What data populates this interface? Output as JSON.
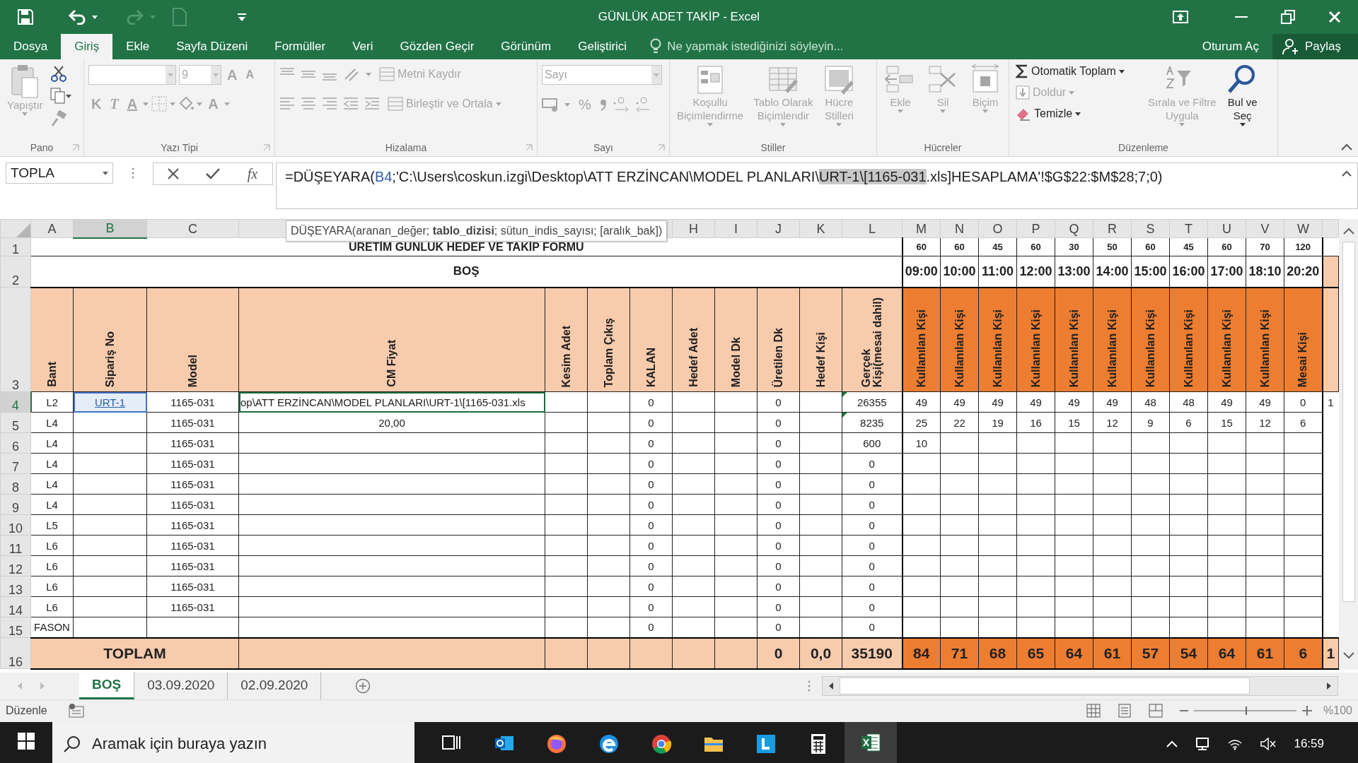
{
  "window": {
    "title": "GÜNLÜK ADET TAKİP - Excel"
  },
  "menu": {
    "tabs": [
      {
        "label": "Dosya",
        "selected": false
      },
      {
        "label": "Giriş",
        "selected": true
      },
      {
        "label": "Ekle",
        "selected": false
      },
      {
        "label": "Sayfa Düzeni",
        "selected": false
      },
      {
        "label": "Formüller",
        "selected": false
      },
      {
        "label": "Veri",
        "selected": false
      },
      {
        "label": "Gözden Geçir",
        "selected": false
      },
      {
        "label": "Görünüm",
        "selected": false
      },
      {
        "label": "Geliştirici",
        "selected": false
      }
    ],
    "tell_me": "Ne yapmak istediğinizi söyleyin...",
    "sign_in": "Oturum Aç",
    "share": "Paylaş"
  },
  "ribbon": {
    "groups": [
      {
        "kind": "clipboard",
        "label": "Pano",
        "paste": {
          "label": "Yapıştır",
          "disabled": true
        }
      },
      {
        "kind": "font",
        "label": "Yazı Tipi",
        "font_size": "9",
        "glyphs": [
          {
            "kind": "grow",
            "text": "A"
          },
          {
            "kind": "shrink",
            "text": "A"
          },
          {
            "kind": "bold",
            "text": "K"
          },
          {
            "kind": "italic",
            "text": "T"
          },
          {
            "kind": "underline",
            "text": "A"
          },
          {
            "kind": "color",
            "text": "A"
          }
        ]
      },
      {
        "kind": "alignment",
        "label": "Hizalama",
        "buttons": [
          {
            "label": "Metni Kaydır",
            "disabled": true
          },
          {
            "label": "Birleştir ve Ortala",
            "disabled": true
          }
        ]
      },
      {
        "kind": "number",
        "label": "Sayı",
        "format": "Sayı",
        "percent": "%"
      },
      {
        "kind": "styles",
        "label": "Stiller",
        "buttons": [
          {
            "lines": [
              "Koşullu",
              "Biçimlendirme"
            ],
            "disabled": true
          },
          {
            "lines": [
              "Tablo Olarak",
              "Biçimlendir"
            ],
            "disabled": true
          },
          {
            "lines": [
              "Hücre",
              "Stilleri"
            ],
            "disabled": true
          }
        ]
      },
      {
        "kind": "cells",
        "label": "Hücreler",
        "buttons": [
          {
            "lines": [
              "Ekle"
            ],
            "disabled": true
          },
          {
            "lines": [
              "Sil"
            ],
            "disabled": true
          },
          {
            "lines": [
              "Biçim"
            ],
            "disabled": true
          }
        ]
      },
      {
        "kind": "editing",
        "label": "Düzenleme",
        "small": [
          {
            "kind": "autosum",
            "label": "Otomatik Toplam",
            "disabled": false
          },
          {
            "kind": "fill",
            "label": "Doldur",
            "disabled": true
          },
          {
            "kind": "clear",
            "label": "Temizle",
            "disabled": false
          }
        ],
        "large": [
          {
            "kind": "sort",
            "lines": [
              "Sırala ve Filtre",
              "Uygula"
            ],
            "disabled": true
          },
          {
            "kind": "find",
            "lines": [
              "Bul ve",
              "Seç"
            ],
            "disabled": false
          }
        ]
      }
    ]
  },
  "formula_bar": {
    "name_box": "TOPLA",
    "fx": "fx",
    "formula": [
      {
        "kind": "plain",
        "text": "=DÜŞEYARA("
      },
      {
        "kind": "reference",
        "text": "B4"
      },
      {
        "kind": "plain",
        "text": ";'C:\\Users\\coskun.izgi\\Desktop\\ATT ERZİNCAN\\MODEL PLANLARI\\"
      },
      {
        "kind": "highlighted",
        "text": "URT-1\\[1165-031"
      },
      {
        "kind": "plain",
        "text": ".xls]HESAPLAMA'!$G$22:$M$28;7;0)"
      }
    ]
  },
  "sheet": {
    "column_headers": [
      "A",
      "B",
      "C",
      "H",
      "I",
      "J",
      "K",
      "L",
      "M",
      "N",
      "O",
      "P",
      "Q",
      "R",
      "S",
      "T",
      "U",
      "V",
      "W"
    ],
    "tooltip": "DÜŞEYARA(aranan_değer; **tablo_dizisi**; sütun_indis_sayısı; [aralık_bak])",
    "rows": [
      {
        "number": "1",
        "kind": "targets",
        "title": "ÜRETİM GÜNLÜK HEDEF VE TAKİP FORMU",
        "cells": {
          "col_13": "60",
          "col_14": "60",
          "col_15": "45",
          "col_16": "60",
          "col_17": "30",
          "col_18": "50",
          "col_19": "60",
          "col_20": "45",
          "col_21": "60",
          "col_22": "70",
          "col_23": "120"
        }
      },
      {
        "number": "2",
        "kind": "times",
        "title": "BOŞ",
        "cells": {
          "col_13": "09:00",
          "col_14": "10:00",
          "col_15": "11:00",
          "col_16": "12:00",
          "col_17": "13:00",
          "col_18": "14:00",
          "col_19": "15:00",
          "col_20": "16:00",
          "col_21": "17:00",
          "col_22": "18:10",
          "col_23": "20:20"
        }
      },
      {
        "number": "3",
        "kind": "header",
        "cells": {
          "col_1": "Bant",
          "col_2": "Sipariş No",
          "col_3": "Model",
          "col_4": "CM Fiyat",
          "col_5": "Kesim Adet",
          "col_6": "Toplam Çıkış",
          "col_7": "KALAN",
          "col_8": "Hedef Adet",
          "col_9": "Model Dk",
          "col_10": "Üretilen Dk",
          "col_11": "Hedef Kişi",
          "col_12": {
            "lines": [
              "Gerçek",
              "Kişi(mesai dahil)"
            ]
          },
          "col_13": "Kullanılan Kişi",
          "col_14": "Kullanılan Kişi",
          "col_15": "Kullanılan Kişi",
          "col_16": "Kullanılan Kişi",
          "col_17": "Kullanılan Kişi",
          "col_18": "Kullanılan Kişi",
          "col_19": "Kullanılan Kişi",
          "col_20": "Kullanılan Kişi",
          "col_21": "Kullanılan Kişi",
          "col_22": "Kullanılan Kişi",
          "col_23": "Mesai Kişi"
        }
      },
      {
        "number": "4",
        "kind": "data",
        "cells": {
          "col_1": "L2",
          "col_2": {
            "text": "URT-1",
            "selected": true,
            "link": true
          },
          "col_3": "1165-031",
          "col_4": {
            "text": "op\\ATT ERZİNCAN\\MODEL PLANLARI\\URT-1\\[1165-031.xls",
            "editing": true
          },
          "col_7": "0",
          "col_10": "0",
          "col_12": {
            "text": "26355",
            "flagged": true
          },
          "col_13": "49",
          "col_14": "49",
          "col_15": "49",
          "col_16": "49",
          "col_17": "49",
          "col_18": "49",
          "col_19": "48",
          "col_20": "48",
          "col_21": "49",
          "col_22": "49",
          "col_23": "0",
          "col_24": "1"
        }
      },
      {
        "number": "5",
        "kind": "data",
        "cells": {
          "col_1": "L4",
          "col_3": "1165-031",
          "col_4": "20,00",
          "col_7": "0",
          "col_10": "0",
          "col_12": {
            "text": "8235",
            "flagged": true
          },
          "col_13": "25",
          "col_14": "22",
          "col_15": "19",
          "col_16": "16",
          "col_17": "15",
          "col_18": "12",
          "col_19": "9",
          "col_20": "6",
          "col_21": "15",
          "col_22": "12",
          "col_23": "6"
        }
      },
      {
        "number": "6",
        "kind": "data",
        "cells": {
          "col_1": "L4",
          "col_3": "1165-031",
          "col_7": "0",
          "col_10": "0",
          "col_12": "600",
          "col_13": "10"
        }
      },
      {
        "number": "7",
        "kind": "data",
        "cells": {
          "col_1": "L4",
          "col_3": "1165-031",
          "col_7": "0",
          "col_10": "0",
          "col_12": "0"
        }
      },
      {
        "number": "8",
        "kind": "data",
        "cells": {
          "col_1": "L4",
          "col_3": "1165-031",
          "col_7": "0",
          "col_10": "0",
          "col_12": "0"
        }
      },
      {
        "number": "9",
        "kind": "data",
        "cells": {
          "col_1": "L4",
          "col_3": "1165-031",
          "col_7": "0",
          "col_10": "0",
          "col_12": "0"
        }
      },
      {
        "number": "10",
        "kind": "data",
        "cells": {
          "col_1": "L5",
          "col_3": "1165-031",
          "col_7": "0",
          "col_10": "0",
          "col_12": "0"
        }
      },
      {
        "number": "11",
        "kind": "data",
        "cells": {
          "col_1": "L6",
          "col_3": "1165-031",
          "col_7": "0",
          "col_10": "0",
          "col_12": "0"
        }
      },
      {
        "number": "12",
        "kind": "data",
        "cells": {
          "col_1": "L6",
          "col_3": "1165-031",
          "col_7": "0",
          "col_10": "0",
          "col_12": "0"
        }
      },
      {
        "number": "13",
        "kind": "data",
        "cells": {
          "col_1": "L6",
          "col_3": "1165-031",
          "col_7": "0",
          "col_10": "0",
          "col_12": "0"
        }
      },
      {
        "number": "14",
        "kind": "data",
        "cells": {
          "col_1": "L6",
          "col_3": "1165-031",
          "col_7": "0",
          "col_10": "0",
          "col_12": "0"
        }
      },
      {
        "number": "15",
        "kind": "data",
        "cells": {
          "col_1": "FASON",
          "col_7": "0",
          "col_10": "0",
          "col_12": "0"
        }
      },
      {
        "number": "16",
        "kind": "total",
        "label": "TOPLAM",
        "cells": {
          "col_10": "0",
          "col_11": "0,0",
          "col_12": "35190",
          "col_13": "84",
          "col_14": "71",
          "col_15": "68",
          "col_16": "65",
          "col_17": "64",
          "col_18": "61",
          "col_19": "57",
          "col_20": "54",
          "col_21": "64",
          "col_22": "61",
          "col_23": "6",
          "col_24": "1"
        }
      }
    ]
  },
  "sheet_tabs": [
    {
      "label": "BOŞ",
      "selected": true
    },
    {
      "label": "03.09.2020",
      "selected": false
    },
    {
      "label": "02.09.2020",
      "selected": false
    }
  ],
  "status_bar": {
    "mode": "Düzenle",
    "zoom": "%100",
    "zoom_slider": {
      "level": 0.5
    }
  },
  "taskbar": {
    "search": {
      "placeholder": "Aramak için buraya yazın"
    },
    "apps": [
      {
        "kind": "taskview",
        "active": false
      },
      {
        "kind": "outlook",
        "active": false
      },
      {
        "kind": "firefox",
        "active": false
      },
      {
        "kind": "edge",
        "active": false
      },
      {
        "kind": "chrome",
        "active": false
      },
      {
        "kind": "explorer",
        "active": false
      },
      {
        "kind": "lapp",
        "active": false
      },
      {
        "kind": "calculator",
        "active": false
      },
      {
        "kind": "excel",
        "active": true
      }
    ],
    "clock": "16:59"
  }
}
